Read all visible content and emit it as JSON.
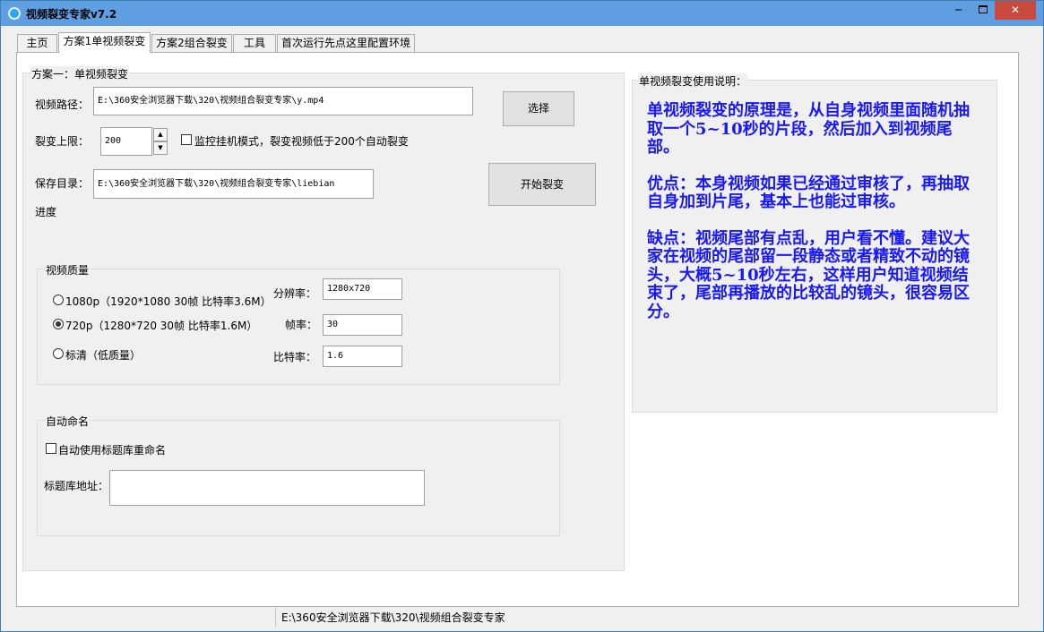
{
  "window": {
    "title": "视频裂变专家v7.2",
    "minimize": "─",
    "close": "✕"
  },
  "tabs": [
    {
      "label": "主页"
    },
    {
      "label": "方案1单视频裂变"
    },
    {
      "label": "方案2组合裂变"
    },
    {
      "label": "工具"
    },
    {
      "label": "首次运行先点这里配置环境"
    }
  ],
  "scheme1": {
    "group_title": "方案一：单视频裂变",
    "video_path_label": "视频路径：",
    "video_path_value": "E:\\360安全浏览器下载\\320\\视频组合裂变专家\\y.mp4",
    "select_button": "选择",
    "limit_label": "裂变上限：",
    "limit_value": "200",
    "spin_up": "▲",
    "spin_down": "▼",
    "monitor_label": "监控挂机模式，裂变视频低于200个自动裂变",
    "save_dir_label": "保存目录：",
    "save_dir_value": "E:\\360安全浏览器下载\\320\\视频组合裂变专家\\liebian",
    "start_button": "开始裂变",
    "progress_label": "进度"
  },
  "quality": {
    "group_title": "视频质量",
    "options": [
      {
        "label": "1080p（1920*1080 30帧 比特率3.6M）",
        "checked": false
      },
      {
        "label": "720p（1280*720 30帧 比特率1.6M）",
        "checked": true
      },
      {
        "label": "标清（低质量）",
        "checked": false
      }
    ],
    "resolution_label": "分辨率：",
    "resolution_value": "1280x720",
    "fps_label": "帧率：",
    "fps_value": "30",
    "bitrate_label": "比特率：",
    "bitrate_value": "1.6"
  },
  "auto_name": {
    "group_title": "自动命名",
    "checkbox_label": "自动使用标题库重命名",
    "checked": false,
    "library_label": "标题库地址：",
    "library_value": ""
  },
  "help": {
    "group_title": "单视频裂变使用说明：",
    "para1": "单视频裂变的原理是，从自身视频里面随机抽取一个5~10秒的片段，然后加入到视频尾部。",
    "para2": "优点：本身视频如果已经通过审核了，再抽取自身加到片尾，基本上也能过审核。",
    "para3": "缺点：视频尾部有点乱，用户看不懂。建议大家在视频的尾部留一段静态或者精致不动的镜头，大概5~10秒左右，这样用户知道视频结束了，尾部再播放的比较乱的镜头，很容易区分。"
  },
  "status": {
    "path": "E:\\360安全浏览器下载\\320\\视频组合裂变专家"
  },
  "colors": {
    "titlebar": "#5f9ee0",
    "help_text": "#1818ff",
    "close_button": "#c94a3c"
  }
}
